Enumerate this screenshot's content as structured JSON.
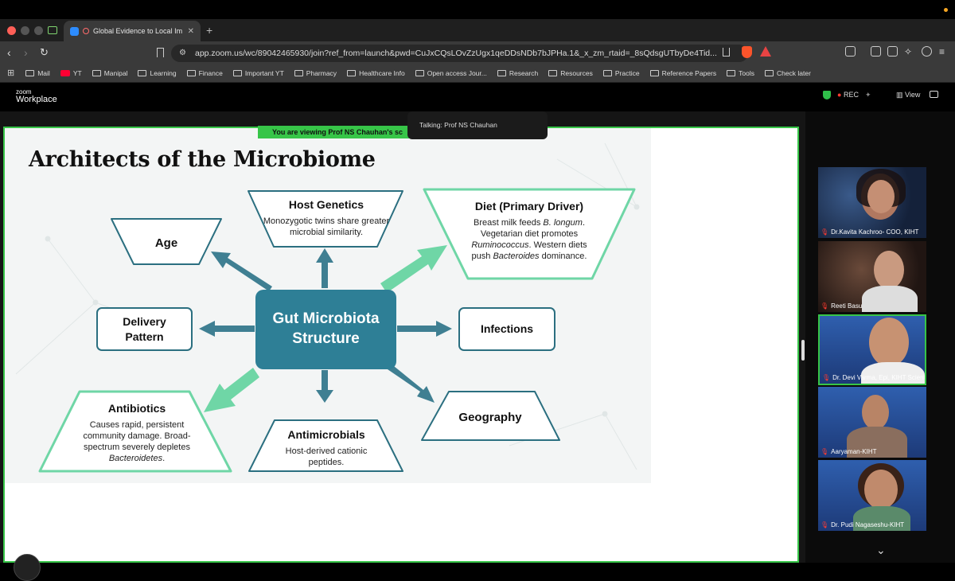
{
  "browser": {
    "tab_title": "Global Evidence to Local Im",
    "url": "app.zoom.us/wc/89042465930/join?ref_from=launch&pwd=CuJxCQsLOvZzUgx1qeDDsNDb7bJPHa.1&_x_zm_rtaid=_8sQdsgUTbyDe4Tid...",
    "bookmarks": [
      "Mail",
      "YT",
      "Manipal",
      "Learning",
      "Finance",
      "Important YT",
      "Pharmacy",
      "Healthcare Info",
      "Open access Jour...",
      "Research",
      "Resources",
      "Practice",
      "Reference Papers",
      "Tools",
      "Check later"
    ]
  },
  "zoom": {
    "logo_small": "zoom",
    "logo_main": "Workplace",
    "rec_label": "REC",
    "view_label": "View",
    "viewing_banner": "You are viewing  Prof NS Chauhan's sc",
    "talking": "Talking: Prof NS Chauhan"
  },
  "slide": {
    "title": "Architects of the Microbiome",
    "hub": "Gut Microbiota Structure",
    "age": "Age",
    "host_genetics": {
      "title": "Host Genetics",
      "text": "Monozygotic twins share greater microbial similarity."
    },
    "diet": {
      "title": "Diet (Primary Driver)",
      "line1": "Breast milk feeds ",
      "line1_em": "B. longum",
      "line1_end": ".",
      "line2": "Vegetarian diet promotes",
      "line3_em": "Ruminococcus",
      "line3": ". Western diets",
      "line4": "push ",
      "line4_em": "Bacteroides",
      "line4_end": " dominance."
    },
    "delivery": "Delivery Pattern",
    "infections": "Infections",
    "antibiotics": {
      "title": "Antibiotics",
      "text": "Causes rapid, persistent community damage. Broad-spectrum severely depletes",
      "em": "Bacteroidetes",
      "end": "."
    },
    "antimicrobials": {
      "title": "Antimicrobials",
      "text": "Host-derived cationic peptides."
    },
    "geography": "Geography"
  },
  "participants": [
    {
      "name": "Dr.Kavita Kachroo- COO, KIHT"
    },
    {
      "name": "Reeti Basu"
    },
    {
      "name": "Dr. Devi Varma, Epi, KIHT Scientis..."
    },
    {
      "name": "Aaryaman-KIHT"
    },
    {
      "name": "Dr. Pudi Nagaseshu-KIHT"
    }
  ],
  "colors": {
    "accent_green": "#37c548",
    "hub_teal": "#2e7f96",
    "arrow_green": "#6fd6a6",
    "arrow_teal": "#3f7f92"
  }
}
